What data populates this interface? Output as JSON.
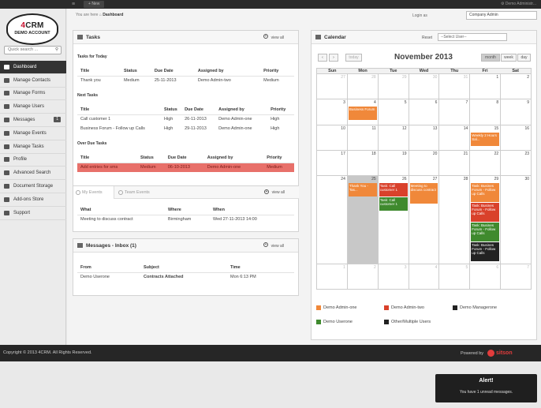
{
  "topbar": {
    "menu_glyph": "≡",
    "new_label": "New",
    "user_label": "Demo Administr..."
  },
  "logo": {
    "prefix": "4",
    "name": "CRM",
    "sub": "DEMO ACCOUNT"
  },
  "sidebar": {
    "search_placeholder": "Quick search ...",
    "items": [
      {
        "label": "Dashboard",
        "icon": "home-icon"
      },
      {
        "label": "Manage Contacts",
        "icon": "contacts-icon"
      },
      {
        "label": "Manage Forms",
        "icon": "forms-icon"
      },
      {
        "label": "Manage Users",
        "icon": "users-icon"
      },
      {
        "label": "Messages",
        "icon": "envelope-icon",
        "badge": "1"
      },
      {
        "label": "Manage Events",
        "icon": "events-icon"
      },
      {
        "label": "Manage Tasks",
        "icon": "tasks-icon"
      },
      {
        "label": "Profile",
        "icon": "profile-icon"
      },
      {
        "label": "Advanced Search",
        "icon": "search-icon"
      },
      {
        "label": "Document Storage",
        "icon": "folder-icon"
      },
      {
        "label": "Add-ons Store",
        "icon": "store-icon"
      },
      {
        "label": "Support",
        "icon": "support-icon"
      }
    ]
  },
  "breadcrumb": {
    "prefix": "You are here",
    "current": "Dashboard"
  },
  "login_as": {
    "label": "Login as",
    "value": "Company Admin"
  },
  "tasks": {
    "title": "Tasks",
    "view_all": "view all",
    "today_heading": "Tasks for Today",
    "today_columns": [
      "Title",
      "Status",
      "Due Date",
      "Assigned by",
      "Priority"
    ],
    "today_rows": [
      [
        "Thank you",
        "Medium",
        "25-11-2013",
        "Demo Admin-two",
        "Medium"
      ]
    ],
    "next_heading": "Next Tasks",
    "next_columns": [
      "Title",
      "Status",
      "Due Date",
      "Assigned by",
      "Priority"
    ],
    "next_rows": [
      [
        "Call customer 1",
        "High",
        "26-11-2013",
        "Demo Admin-one",
        "High"
      ],
      [
        "Business Forum - Follow up Calls",
        "High",
        "29-11-2013",
        "Demo Admin-one",
        "High"
      ]
    ],
    "overdue_heading": "Over Due Tasks",
    "overdue_columns": [
      "Title",
      "Status",
      "Due Date",
      "Assigned by",
      "Priority"
    ],
    "overdue_rows": [
      [
        "Add entries for sms",
        "Medium",
        "06-10-2013",
        "Demo Admin-one",
        "Medium"
      ]
    ]
  },
  "events": {
    "tab_my": "My Events",
    "tab_team": "Team Events",
    "view_all": "view all",
    "columns": [
      "What",
      "Where",
      "When"
    ],
    "rows": [
      [
        "Meeting to discuss contract",
        "Birmingham",
        "Wed 27-11-2013 14:00"
      ]
    ]
  },
  "messages": {
    "title": "Messages - Inbox (1)",
    "view_all": "view all",
    "columns": [
      "From",
      "Subject",
      "Time"
    ],
    "rows": [
      [
        "Demo Userone",
        "Contracts Attached",
        "Mon 6:13 PM"
      ]
    ]
  },
  "calendar": {
    "title": "Calendar",
    "reset_label": "Reset",
    "user_select": "--Select User--",
    "today_btn": "today",
    "prev": "‹",
    "next": "›",
    "month_label": "November 2013",
    "views": [
      "month",
      "week",
      "day"
    ],
    "day_names": [
      "Sun",
      "Mon",
      "Tue",
      "Wed",
      "Thu",
      "Fri",
      "Sat"
    ],
    "weeks": [
      [
        "27",
        "28",
        "29",
        "30",
        "31",
        "1",
        "2"
      ],
      [
        "3",
        "4",
        "5",
        "6",
        "7",
        "8",
        "9"
      ],
      [
        "10",
        "11",
        "12",
        "13",
        "14",
        "15",
        "16"
      ],
      [
        "17",
        "18",
        "19",
        "20",
        "21",
        "22",
        "23"
      ],
      [
        "24",
        "25",
        "26",
        "27",
        "28",
        "29",
        "30"
      ],
      [
        "1",
        "2",
        "3",
        "4",
        "5",
        "6",
        "7"
      ]
    ],
    "events": [
      {
        "text": "Business Forum",
        "color": "#f0883a"
      },
      {
        "text": "Weekly 2 Hours Sal...",
        "color": "#f0883a"
      },
      {
        "text": "Thank You - Tas...",
        "color": "#f0883a"
      },
      {
        "text": "Task: Call customer 1",
        "color": "#d9412b"
      },
      {
        "text": "Task: Call customer 1",
        "color": "#3f8a2e"
      },
      {
        "text": "Meeting to discuss contract",
        "color": "#f0883a"
      },
      {
        "text": "Task: Busines Forum - Follow up Calls",
        "color": "#f0883a"
      },
      {
        "text": "Task: Busines Forum - Follow up Calls",
        "color": "#d9412b"
      },
      {
        "text": "Task: Busines Forum - Follow up Calls",
        "color": "#3f8a2e"
      },
      {
        "text": "Task: Busines Forum - Follow up Calls",
        "color": "#222222"
      }
    ],
    "legend": [
      {
        "label": "Demo Admin-one",
        "color": "#f0883a"
      },
      {
        "label": "Demo Admin-two",
        "color": "#d9412b"
      },
      {
        "label": "Demo Managerone",
        "color": "#222222"
      },
      {
        "label": "Demo Userone",
        "color": "#3f8a2e"
      },
      {
        "label": "Other/Multiple Users",
        "color": "#222222"
      }
    ]
  },
  "footer": {
    "copyright": "Copyright © 2013 4CRM. All Rights Reserved.",
    "powered": "Powered by",
    "brand": "sitson"
  },
  "alert": {
    "title": "Alert!",
    "message": "You have 1 unread messages."
  }
}
